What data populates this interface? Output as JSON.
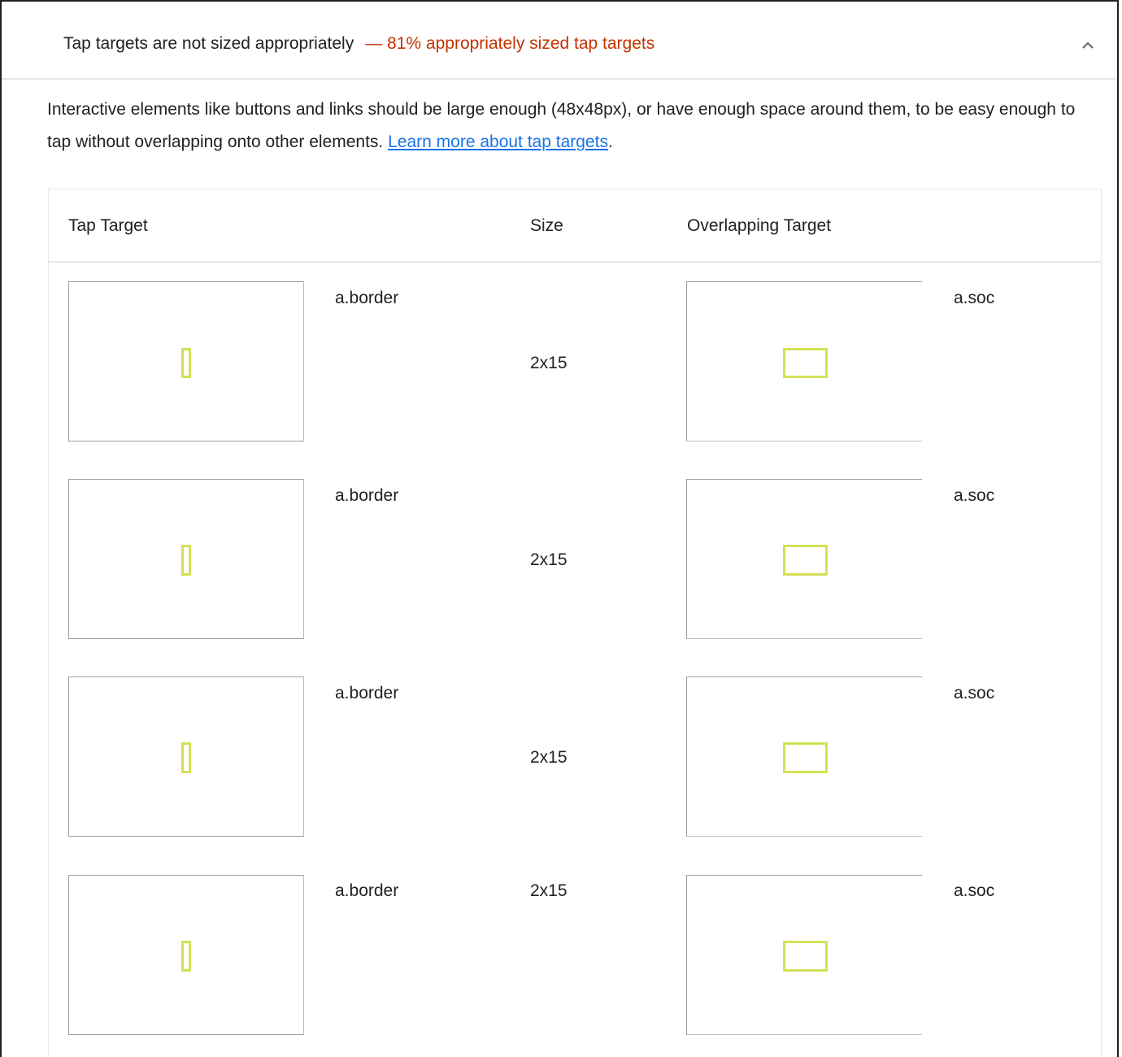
{
  "audit": {
    "title": "Tap targets are not sized appropriately",
    "display_value": "— 81% appropriately sized tap targets",
    "chevron_icon": "chevron-up-icon",
    "description_text": "Interactive elements like buttons and links should be large enough (48x48px), or have enough space around them, to be easy enough to tap without overlapping onto other elements. ",
    "description_link": "Learn more about tap targets",
    "description_end": ".",
    "colors": {
      "display_value": "#c33300",
      "link": "#1a73e8",
      "highlight": "#d4e157"
    }
  },
  "table": {
    "headers": {
      "tap_target": "Tap Target",
      "size": "Size",
      "overlapping_target": "Overlapping Target"
    },
    "rows": [
      {
        "tap_target": "a.border",
        "size": "2x15",
        "overlapping_target": "a.soc"
      },
      {
        "tap_target": "a.border",
        "size": "2x15",
        "overlapping_target": "a.soc"
      },
      {
        "tap_target": "a.border",
        "size": "2x15",
        "overlapping_target": "a.soc"
      },
      {
        "tap_target": "a.border",
        "size": "2x15",
        "overlapping_target": "a.soc"
      }
    ]
  }
}
